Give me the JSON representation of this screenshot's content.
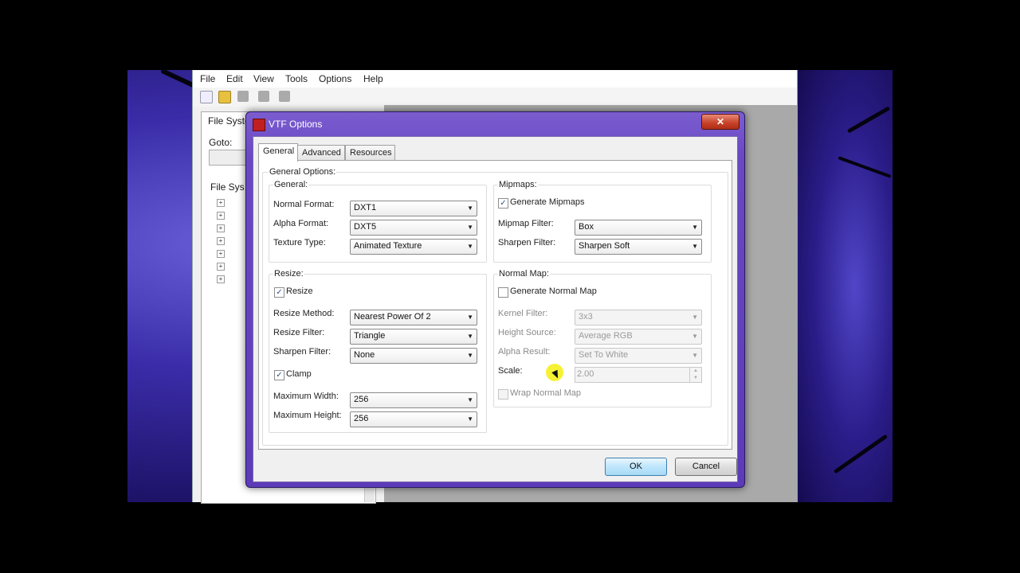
{
  "app": {
    "menu": [
      "File",
      "Edit",
      "View",
      "Tools",
      "Options",
      "Help"
    ],
    "left_tab": "File Syster",
    "goto_label": "Goto:",
    "fs_label": "File Sys"
  },
  "dialog": {
    "title": "VTF Options",
    "close_label": "✕",
    "tabs": [
      "General",
      "Advanced",
      "Resources"
    ],
    "general_options_label": "General Options:",
    "general": {
      "title": "General:",
      "normal_format_label": "Normal Format:",
      "normal_format_value": "DXT1",
      "alpha_format_label": "Alpha Format:",
      "alpha_format_value": "DXT5",
      "texture_type_label": "Texture Type:",
      "texture_type_value": "Animated Texture"
    },
    "mipmaps": {
      "title": "Mipmaps:",
      "generate_label": "Generate Mipmaps",
      "generate_checked": true,
      "filter_label": "Mipmap Filter:",
      "filter_value": "Box",
      "sharpen_label": "Sharpen Filter:",
      "sharpen_value": "Sharpen Soft"
    },
    "resize": {
      "title": "Resize:",
      "resize_label": "Resize",
      "resize_checked": true,
      "method_label": "Resize Method:",
      "method_value": "Nearest Power Of 2",
      "filter_label": "Resize Filter:",
      "filter_value": "Triangle",
      "sharpen_label": "Sharpen Filter:",
      "sharpen_value": "None",
      "clamp_label": "Clamp",
      "clamp_checked": true,
      "max_width_label": "Maximum Width:",
      "max_width_value": "256",
      "max_height_label": "Maximum Height:",
      "max_height_value": "256"
    },
    "normal_map": {
      "title": "Normal Map:",
      "generate_label": "Generate Normal Map",
      "generate_checked": false,
      "kernel_label": "Kernel Filter:",
      "kernel_value": "3x3",
      "height_label": "Height Source:",
      "height_value": "Average RGB",
      "alpha_label": "Alpha Result:",
      "alpha_value": "Set To White",
      "scale_label": "Scale:",
      "scale_value": "2.00",
      "wrap_label": "Wrap Normal Map",
      "wrap_checked": false
    },
    "ok_label": "OK",
    "cancel_label": "Cancel"
  }
}
